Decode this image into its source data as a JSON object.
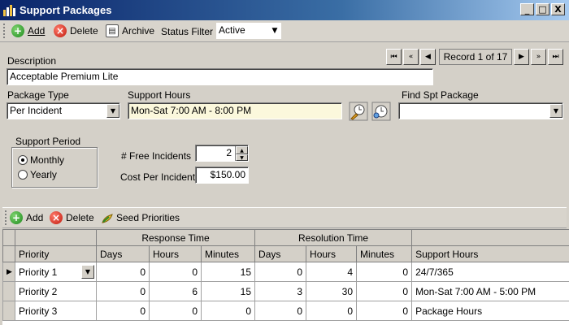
{
  "window": {
    "title": "Support Packages",
    "controls": {
      "minimize": "_",
      "maximize": "□",
      "close": "X"
    }
  },
  "toolbar": {
    "add_label": "Add",
    "delete_label": "Delete",
    "archive_label": "Archive",
    "status_filter_label": "Status Filter",
    "status_filter_value": "Active"
  },
  "navigator": {
    "record_text": "Record 1 of 17",
    "first": "⏮",
    "prev_page": "«",
    "prev": "◀",
    "next": "▶",
    "next_page": "»",
    "last": "⏭"
  },
  "form": {
    "description_label": "Description",
    "description_value": "Acceptable Premium Lite",
    "package_type_label": "Package Type",
    "package_type_value": "Per Incident",
    "support_hours_label": "Support Hours",
    "support_hours_value": "Mon-Sat 7:00 AM - 8:00 PM",
    "find_label": "Find Spt Package",
    "find_value": "",
    "support_period_label": "Support Period",
    "period_options": [
      "Monthly",
      "Yearly"
    ],
    "period_selected": "Monthly",
    "free_incidents_label": "# Free Incidents",
    "free_incidents_value": "2",
    "cost_label": "Cost Per Incident",
    "cost_value": "$150.00"
  },
  "grid_toolbar": {
    "add_label": "Add",
    "delete_label": "Delete",
    "seed_label": "Seed Priorities"
  },
  "grid": {
    "group_headers": {
      "response": "Response Time",
      "resolution": "Resolution Time"
    },
    "columns": [
      "Priority",
      "Days",
      "Hours",
      "Minutes",
      "Days",
      "Hours",
      "Minutes",
      "Support Hours"
    ],
    "rows": [
      {
        "priority": "Priority 1",
        "resp_days": "0",
        "resp_hours": "0",
        "resp_minutes": "15",
        "res_days": "0",
        "res_hours": "4",
        "res_minutes": "0",
        "hours": "24/7/365"
      },
      {
        "priority": "Priority 2",
        "resp_days": "0",
        "resp_hours": "6",
        "resp_minutes": "15",
        "res_days": "3",
        "res_hours": "30",
        "res_minutes": "0",
        "hours": "Mon-Sat 7:00 AM - 5:00 PM"
      },
      {
        "priority": "Priority 3",
        "resp_days": "0",
        "resp_hours": "0",
        "resp_minutes": "0",
        "res_days": "0",
        "res_hours": "0",
        "res_minutes": "0",
        "hours": "Package Hours"
      }
    ]
  }
}
